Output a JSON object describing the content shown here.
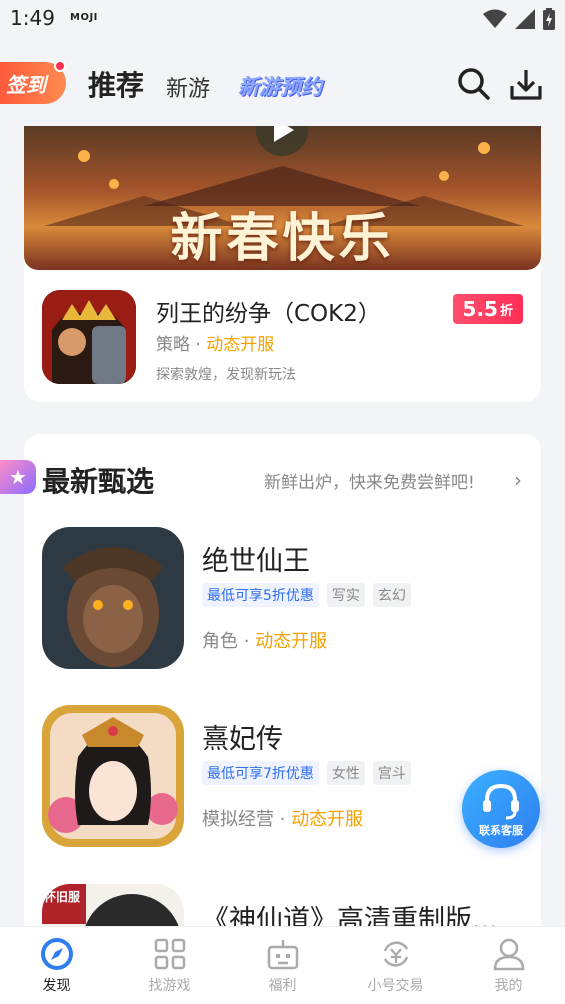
{
  "status_bar": {
    "time": "1:49",
    "carrier_logo": "MOJI",
    "icons": [
      "wifi-icon",
      "signal-icon",
      "battery-icon"
    ]
  },
  "top_nav": {
    "signin_label": "签到",
    "tabs": [
      {
        "label": "推荐",
        "active": true
      },
      {
        "label": "新游",
        "active": false
      },
      {
        "label": "新游预约",
        "active": false
      }
    ],
    "icons": [
      "search-icon",
      "download-icon"
    ]
  },
  "featured": {
    "banner_text": "新春快乐",
    "game": {
      "title": "列王的纷争（COK2）",
      "category": "策略",
      "server_status": "动态开服",
      "description": "探索敦煌，发现新玩法",
      "discount_value": "5.5",
      "discount_unit": "折"
    }
  },
  "latest": {
    "title": "最新甄选",
    "subtitle": "新鲜出炉，快来免费尝鲜吧!",
    "games": [
      {
        "name": "绝世仙王",
        "tags": [
          "最低可享5折优惠",
          "写实",
          "玄幻"
        ],
        "category": "角色",
        "server_status": "动态开服"
      },
      {
        "name": "熹妃传",
        "tags": [
          "最低可享7折优惠",
          "女性",
          "宫斗"
        ],
        "category": "模拟经营",
        "server_status": "动态开服"
      },
      {
        "name": "《神仙道》高清重制版...",
        "badge": "怀旧服"
      }
    ]
  },
  "support": {
    "label": "联系客服"
  },
  "bottom_nav": [
    {
      "label": "发现",
      "icon": "compass-icon",
      "active": true
    },
    {
      "label": "找游戏",
      "icon": "grid-icon",
      "active": false
    },
    {
      "label": "福利",
      "icon": "gift-icon",
      "active": false
    },
    {
      "label": "小号交易",
      "icon": "exchange-icon",
      "active": false
    },
    {
      "label": "我的",
      "icon": "user-icon",
      "active": false
    }
  ],
  "colors": {
    "accent_orange": "#f5a100",
    "discount_red": "#ff2f56",
    "active_blue": "#2f7ef0"
  }
}
